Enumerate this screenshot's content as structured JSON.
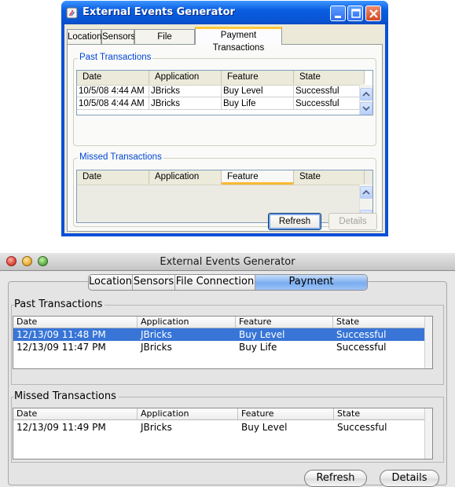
{
  "xp_window": {
    "title": "External Events Generator",
    "tabs": [
      "Location",
      "Sensors",
      "File Connection",
      "Payment Transactions"
    ],
    "active_tab": "Payment Transactions",
    "past": {
      "title": "Past Transactions",
      "columns": [
        "Date",
        "Application",
        "Feature",
        "State"
      ],
      "rows": [
        [
          "10/5/08 4:44 AM",
          "JBricks",
          "Buy Level",
          "Successful"
        ],
        [
          "10/5/08 4:44 AM",
          "JBricks",
          "Buy Life",
          "Successful"
        ]
      ]
    },
    "missed": {
      "title": "Missed Transactions",
      "columns": [
        "Date",
        "Application",
        "Feature",
        "State"
      ],
      "rows": []
    },
    "refresh_label": "Refresh",
    "details_label": "Details"
  },
  "mac_window": {
    "title": "External Events Generator",
    "tabs": [
      "Location",
      "Sensors",
      "File Connection",
      "Payment Transactions"
    ],
    "active_tab": "Payment Transactions",
    "past": {
      "title": "Past Transactions",
      "columns": [
        "Date",
        "Application",
        "Feature",
        "State"
      ],
      "rows": [
        [
          "12/13/09 11:48 PM",
          "JBricks",
          "Buy Level",
          "Successful"
        ],
        [
          "12/13/09 11:47 PM",
          "JBricks",
          "Buy Life",
          "Successful"
        ]
      ],
      "selected_row": 0
    },
    "missed": {
      "title": "Missed Transactions",
      "columns": [
        "Date",
        "Application",
        "Feature",
        "State"
      ],
      "rows": [
        [
          "12/13/09 11:49 PM",
          "JBricks",
          "Buy Level",
          "Successful"
        ]
      ]
    },
    "refresh_label": "Refresh",
    "details_label": "Details"
  },
  "colors": {
    "xp_title": "#0a5ee0",
    "xp_group_title": "#0046d5",
    "mac_selection": "#3875d7",
    "mac_close": "#e0463c",
    "mac_minimize": "#e9b03a",
    "mac_zoom": "#5fb346"
  },
  "icons": [
    "app-icon",
    "minimize-icon",
    "maximize-icon",
    "close-icon",
    "scroll-up-icon",
    "scroll-down-icon"
  ]
}
